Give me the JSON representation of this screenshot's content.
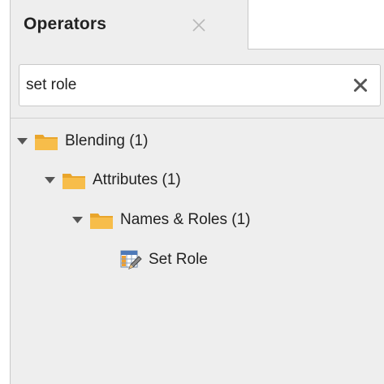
{
  "tab": {
    "title": "Operators"
  },
  "search": {
    "value": "set role"
  },
  "tree": {
    "blending": "Blending (1)",
    "attributes": "Attributes (1)",
    "names_roles": "Names & Roles (1)",
    "set_role": "Set Role"
  },
  "colors": {
    "folder": "#f4b63f",
    "panel_bg": "#eeeeee",
    "text": "#222222"
  },
  "icons": {
    "tab_close": "close-icon",
    "search_clear": "clear-icon",
    "expand": "caret-down-icon",
    "folder": "folder-icon",
    "operator": "set-role-operator-icon"
  }
}
